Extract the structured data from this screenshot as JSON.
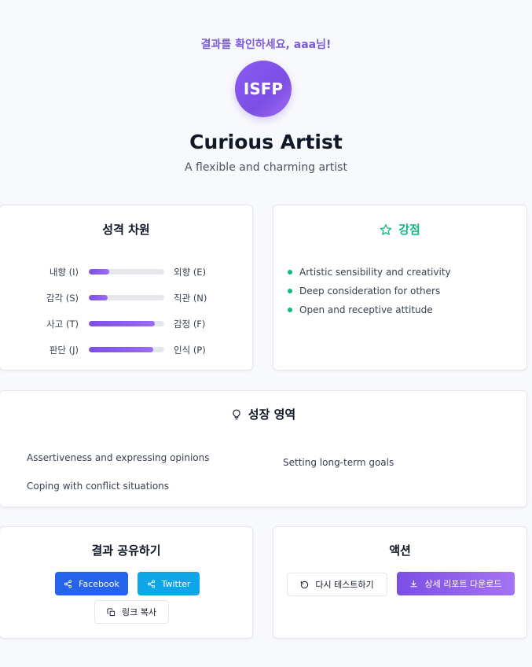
{
  "header": {
    "greeting": "결과를 확인하세요, aaa님!",
    "type_code": "ISFP",
    "type_name": "Curious Artist",
    "type_description": "A flexible and charming artist"
  },
  "dimensions": {
    "title": "성격 차원",
    "rows": [
      {
        "left": "내향 (I)",
        "right": "외향 (E)",
        "fill_fraction": 0.27
      },
      {
        "left": "감각 (S)",
        "right": "직관 (N)",
        "fill_fraction": 0.25
      },
      {
        "left": "사고 (T)",
        "right": "감정 (F)",
        "fill_fraction": 0.87
      },
      {
        "left": "판단 (J)",
        "right": "인식 (P)",
        "fill_fraction": 0.85
      }
    ]
  },
  "strengths": {
    "title": "강점",
    "icon": "star-icon",
    "items": [
      "Artistic sensibility and creativity",
      "Deep consideration for others",
      "Open and receptive attitude"
    ]
  },
  "growth": {
    "title": "성장 영역",
    "icon": "lightbulb-icon",
    "items": [
      "Assertiveness and expressing opinions",
      "Setting long-term goals",
      "Coping with conflict situations"
    ]
  },
  "share": {
    "title": "결과 공유하기",
    "facebook": "Facebook",
    "twitter": "Twitter",
    "copy_link": "링크 복사"
  },
  "actions": {
    "title": "액션",
    "retake": "다시 테스트하기",
    "download": "상세 리포트 다운로드"
  },
  "colors": {
    "accent_purple": "#7c4ee4",
    "strength_green": "#10b981",
    "facebook_blue": "#2563eb",
    "twitter_blue": "#0ea5e9"
  }
}
